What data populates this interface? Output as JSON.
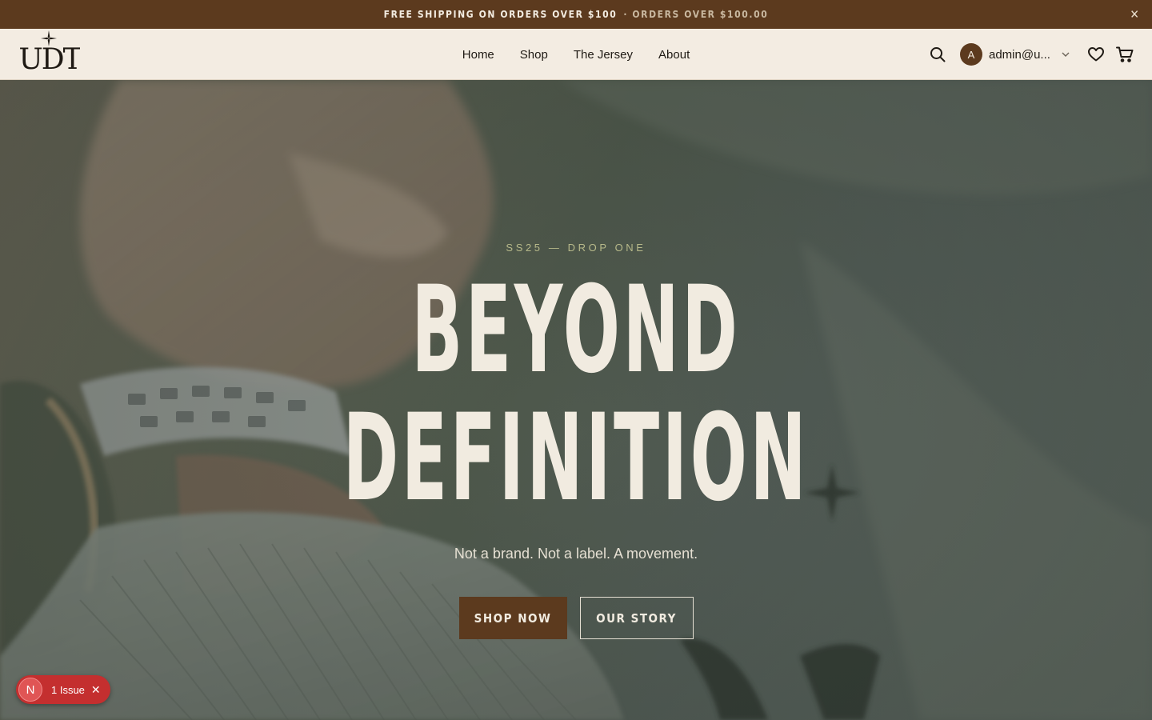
{
  "announcement": {
    "text": "FREE SHIPPING ON ORDERS OVER $100",
    "secondary": "· ORDERS OVER $100.00",
    "close_icon": "close-icon"
  },
  "header": {
    "logo_text": "UDT",
    "nav": [
      {
        "label": "Home"
      },
      {
        "label": "Shop"
      },
      {
        "label": "The Jersey"
      },
      {
        "label": "About"
      }
    ],
    "avatar_initial": "A",
    "user_email": "admin@u...",
    "icons": [
      "search-icon",
      "chevron-down-icon",
      "heart-icon",
      "cart-icon"
    ]
  },
  "hero": {
    "eyebrow": "SS25 — DROP ONE",
    "headline_line1": "BEYOND",
    "headline_line2": "DEFINITION",
    "tagline": "Not a brand. Not a label. A movement.",
    "primary_cta": "SHOP NOW",
    "secondary_cta": "OUR STORY"
  },
  "dev_badge": {
    "initial": "N",
    "label": "1 Issue"
  },
  "colors": {
    "brand_brown": "#5c3a1e",
    "header_bg": "#f3ece2",
    "cream_text": "#f1ebe0",
    "eyebrow": "#b7b98a",
    "issue_red": "#c42f2f"
  }
}
